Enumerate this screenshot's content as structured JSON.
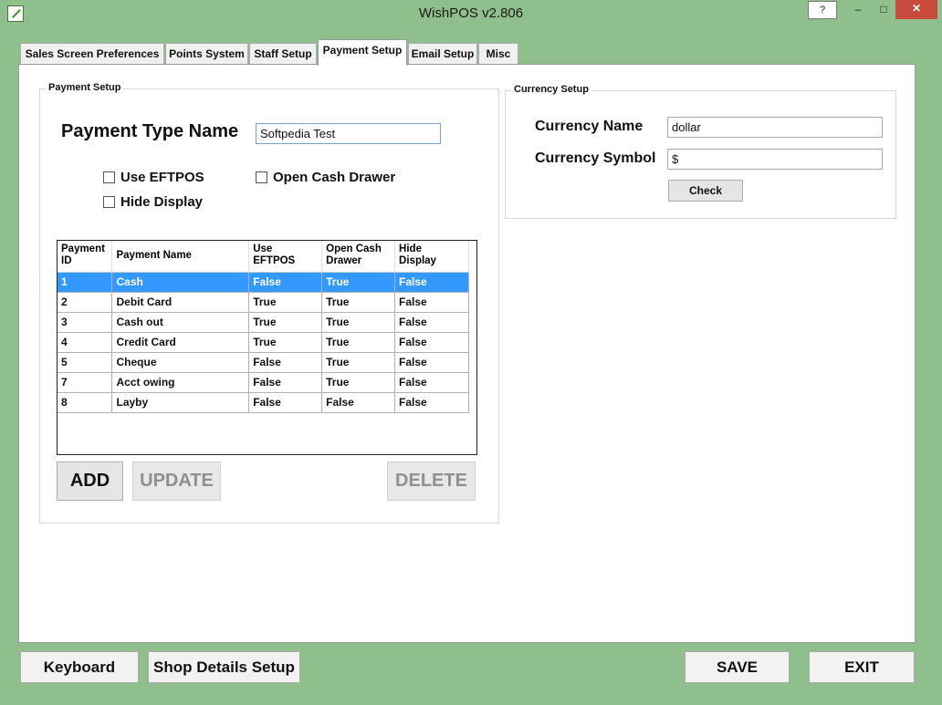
{
  "window": {
    "title": "WishPOS v2.806",
    "help_label": "?",
    "minimize_label": "–",
    "maximize_label": "□",
    "close_label": "✕"
  },
  "tabs": [
    {
      "label": "Sales Screen Preferences"
    },
    {
      "label": "Points System"
    },
    {
      "label": "Staff Setup"
    },
    {
      "label": "Payment Setup"
    },
    {
      "label": "Email Setup"
    },
    {
      "label": "Misc"
    }
  ],
  "payment_setup": {
    "legend": "Payment Setup",
    "name_label": "Payment Type Name",
    "name_value": "Softpedia Test",
    "use_eftpos_label": "Use EFTPOS",
    "use_eftpos_checked": false,
    "open_cash_drawer_label": "Open Cash Drawer",
    "open_cash_drawer_checked": false,
    "hide_display_label": "Hide Display",
    "hide_display_checked": false,
    "grid": {
      "columns": [
        {
          "line1": "Payment",
          "line2": "ID"
        },
        {
          "line1": "Payment Name",
          "line2": ""
        },
        {
          "line1": "Use",
          "line2": "EFTPOS"
        },
        {
          "line1": "Open Cash",
          "line2": "Drawer"
        },
        {
          "line1": "Hide",
          "line2": "Display"
        }
      ],
      "rows": [
        {
          "id": "1",
          "name": "Cash",
          "eftpos": "False",
          "drawer": "True",
          "hide": "False",
          "selected": true
        },
        {
          "id": "2",
          "name": "Debit Card",
          "eftpos": "True",
          "drawer": "True",
          "hide": "False",
          "selected": false
        },
        {
          "id": "3",
          "name": "Cash out",
          "eftpos": "True",
          "drawer": "True",
          "hide": "False",
          "selected": false
        },
        {
          "id": "4",
          "name": "Credit Card",
          "eftpos": "True",
          "drawer": "True",
          "hide": "False",
          "selected": false
        },
        {
          "id": "5",
          "name": "Cheque",
          "eftpos": "False",
          "drawer": "True",
          "hide": "False",
          "selected": false
        },
        {
          "id": "7",
          "name": "Acct owing",
          "eftpos": "False",
          "drawer": "True",
          "hide": "False",
          "selected": false
        },
        {
          "id": "8",
          "name": "Layby",
          "eftpos": "False",
          "drawer": "False",
          "hide": "False",
          "selected": false
        }
      ]
    },
    "add_label": "ADD",
    "update_label": "UPDATE",
    "delete_label": "DELETE"
  },
  "currency_setup": {
    "legend": "Currency Setup",
    "name_label": "Currency Name",
    "name_value": "dollar",
    "symbol_label": "Currency Symbol",
    "symbol_value": "$",
    "check_label": "Check"
  },
  "footer": {
    "keyboard_label": "Keyboard",
    "shop_details_label": "Shop Details Setup",
    "save_label": "SAVE",
    "exit_label": "EXIT"
  }
}
